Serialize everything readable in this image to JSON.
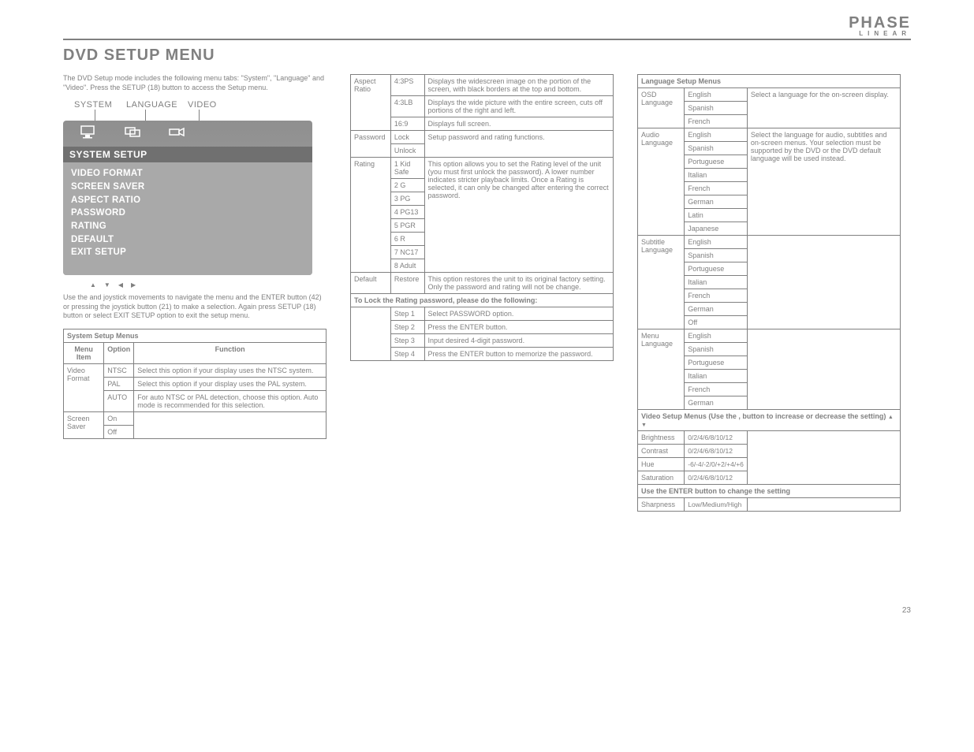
{
  "logo": {
    "top": "PHASE",
    "bot": "LINEAR"
  },
  "title": "DVD SETUP MENU",
  "intro1": "The DVD Setup mode includes the following menu tabs: \"System\", \"Language\" and \"Video\". Press the SETUP (18) button to access the Setup menu.",
  "osd_labels": {
    "system": "SYSTEM",
    "language": "LANGUAGE",
    "video": "VIDEO"
  },
  "osd_title": "SYSTEM SETUP",
  "osd_items": [
    "VIDEO FORMAT",
    "SCREEN SAVER",
    "ASPECT RATIO",
    "PASSWORD",
    "RATING",
    "DEFAULT",
    "EXIT SETUP"
  ],
  "instr": "Use the        and   joystick movements to navigate the menu and the ENTER button (42) or pressing the joystick button (21) to make a selection. Again press SETUP (18) button or select EXIT SETUP option to exit the setup menu.",
  "table_headers": [
    "Menu Item",
    "Option",
    "Function"
  ],
  "system_section": "System Setup Menus",
  "system_rows": [
    {
      "item": "Video Format",
      "opts": [
        {
          "o": "NTSC",
          "f": "Select this option if your display uses the NTSC system."
        },
        {
          "o": "PAL",
          "f": "Select this option if your display uses the PAL system."
        },
        {
          "o": "AUTO",
          "f": "For auto NTSC or PAL detection, choose this option. Auto mode is recommended for this selection."
        }
      ]
    },
    {
      "item": "Screen Saver",
      "opts": [
        {
          "o": "On",
          "f": ""
        },
        {
          "o": "Off",
          "f": ""
        }
      ]
    },
    {
      "item": "Aspect Ratio",
      "opts": [
        {
          "o": "4:3PS",
          "f": "Displays the widescreen image on the portion of the screen, with black borders at the top and bottom."
        },
        {
          "o": "4:3LB",
          "f": "Displays the wide picture with the entire screen, cuts off portions of the right and left."
        },
        {
          "o": "16:9",
          "f": "Displays full screen."
        }
      ]
    },
    {
      "item": "Password",
      "opts": [
        {
          "o": "Lock",
          "f": "Setup password and rating functions."
        },
        {
          "o": "Unlock",
          "f": ""
        }
      ]
    },
    {
      "item": "Rating",
      "opts": [
        {
          "o": "1 Kid Safe",
          "f": "This option allows you to set the Rating level of the unit (you must first unlock the password). A lower number indicates stricter playback limits. Once a Rating is selected, it can only be changed after entering the correct password."
        },
        {
          "o": "2 G",
          "f": ""
        },
        {
          "o": "3 PG",
          "f": ""
        },
        {
          "o": "4 PG13",
          "f": ""
        },
        {
          "o": "5 PGR",
          "f": ""
        },
        {
          "o": "6 R",
          "f": ""
        },
        {
          "o": "7 NC17",
          "f": ""
        },
        {
          "o": "8 Adult",
          "f": ""
        }
      ]
    },
    {
      "item": "Default",
      "opts": [
        {
          "o": "Restore",
          "f": "This option restores the unit to its original factory setting. Only the password and rating will not be change."
        }
      ]
    }
  ],
  "pass_section": "To Lock the Rating password, please do the following:",
  "pass_rows": [
    {
      "o": "Step 1",
      "f": "Select PASSWORD option."
    },
    {
      "o": "Step 2",
      "f": "Press the ENTER button."
    },
    {
      "o": "Step 3",
      "f": "Input desired 4-digit password."
    },
    {
      "o": "Step 4",
      "f": "Press the ENTER button to memorize the password."
    }
  ],
  "lang_section": "Language Setup Menus",
  "lang_rows": [
    {
      "item": "OSD Language",
      "opts": [
        {
          "o": "English",
          "f": "Select a language for the on-screen display."
        },
        {
          "o": "Spanish",
          "f": ""
        },
        {
          "o": "French",
          "f": ""
        }
      ]
    },
    {
      "item": "Audio Language",
      "opts": [
        {
          "o": "English",
          "f": "Select the language for audio, subtitles and on-screen menus. Your selection must be supported by the DVD or the DVD default language will be used instead."
        },
        {
          "o": "Spanish",
          "f": ""
        },
        {
          "o": "Portuguese",
          "f": ""
        },
        {
          "o": "Italian",
          "f": ""
        },
        {
          "o": "French",
          "f": ""
        },
        {
          "o": "German",
          "f": ""
        },
        {
          "o": "Latin",
          "f": ""
        },
        {
          "o": "Japanese",
          "f": ""
        }
      ]
    },
    {
      "item": "Subtitle Language",
      "opts": [
        {
          "o": "English",
          "f": ""
        },
        {
          "o": "Spanish",
          "f": ""
        },
        {
          "o": "Portuguese",
          "f": ""
        },
        {
          "o": "Italian",
          "f": ""
        },
        {
          "o": "French",
          "f": ""
        },
        {
          "o": "German",
          "f": ""
        },
        {
          "o": "Off",
          "f": ""
        }
      ]
    },
    {
      "item": "Menu Language",
      "opts": [
        {
          "o": "English",
          "f": ""
        },
        {
          "o": "Spanish",
          "f": ""
        },
        {
          "o": "Portuguese",
          "f": ""
        },
        {
          "o": "Italian",
          "f": ""
        },
        {
          "o": "French",
          "f": ""
        },
        {
          "o": "German",
          "f": ""
        }
      ]
    }
  ],
  "video_section": "Video Setup Menus (Use the    ,    button to increase or decrease the setting)",
  "video_rows": [
    {
      "item": "Brightness",
      "opts": [
        {
          "o": "0/2/4/6/8/10/12",
          "f": ""
        }
      ]
    },
    {
      "item": "Contrast",
      "opts": [
        {
          "o": "0/2/4/6/8/10/12",
          "f": ""
        }
      ]
    },
    {
      "item": "Hue",
      "opts": [
        {
          "o": "-6/-4/-2/0/+2/+4/+6",
          "f": ""
        }
      ]
    },
    {
      "item": "Saturation",
      "opts": [
        {
          "o": "0/2/4/6/8/10/12",
          "f": ""
        }
      ]
    }
  ],
  "sharp_section": "Use the ENTER button to change the setting",
  "sharp_rows": [
    {
      "item": "Sharpness",
      "opts": [
        {
          "o": "Low/Medium/High",
          "f": ""
        }
      ]
    }
  ],
  "page_num": "23"
}
